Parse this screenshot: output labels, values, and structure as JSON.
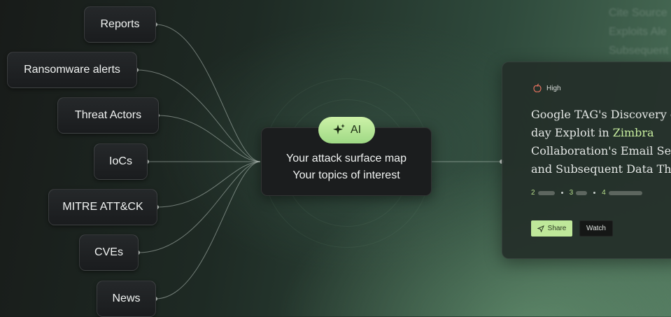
{
  "sources": [
    {
      "label": "Reports"
    },
    {
      "label": "Ransomware alerts"
    },
    {
      "label": "Threat Actors"
    },
    {
      "label": "IoCs"
    },
    {
      "label": "MITRE ATT&CK"
    },
    {
      "label": "CVEs"
    },
    {
      "label": "News"
    }
  ],
  "hub": {
    "badge_icon": "sparkles-icon",
    "badge_label": "AI",
    "line1": "Your attack surface map",
    "line2": "Your topics of interest"
  },
  "card": {
    "severity_icon": "apple-icon",
    "severity": "High",
    "headline_lines": [
      "Google TAG's Discovery o",
      "day Exploit in ",
      "Zimbra",
      "Collaboration's Email Serv",
      "and Subsequent Data The"
    ],
    "stats": [
      {
        "label": "2",
        "fill": 0.3
      },
      {
        "label": "3",
        "fill": 0.2
      },
      {
        "label": "4",
        "fill": 0.6
      }
    ],
    "share_label": "Share",
    "watch_label": "Watch"
  },
  "colors": {
    "accent": "#bfe89a",
    "highlight": "#c8ee9f",
    "node_bg": "#1f2224"
  }
}
